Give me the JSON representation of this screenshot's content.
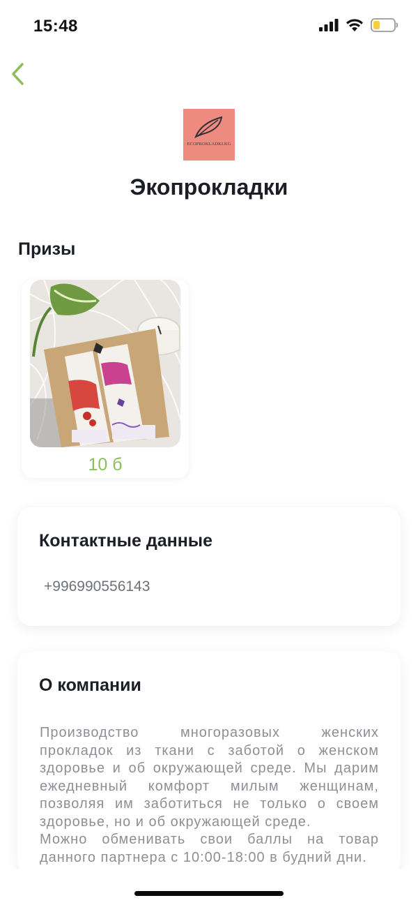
{
  "status_bar": {
    "time": "15:48",
    "battery_color": "#f4cf3f"
  },
  "nav": {
    "back_icon": "chevron-left-icon",
    "accent_color": "#8cbf5a"
  },
  "company": {
    "logo_text": "ECOPROKLADKI.KG",
    "logo_bg": "#ee8a80",
    "name": "Экопрокладки"
  },
  "prizes": {
    "title": "Призы",
    "items": [
      {
        "points": "10 б"
      }
    ]
  },
  "contacts": {
    "title": "Контактные данные",
    "phone": "+996990556143"
  },
  "about": {
    "title": "О компании",
    "paragraphs": [
      "Производство многоразовых женских прокладок из ткани с  заботой о женском здоровье и об окружающей среде. Мы дарим ежедневный комфорт милым женщинам, позволяя им заботиться не только о своем здоровье, но и об окружающей среде.",
      "Можно обменивать свои баллы на товар данного партнера с 10:00-18:00 в будний дни."
    ]
  }
}
